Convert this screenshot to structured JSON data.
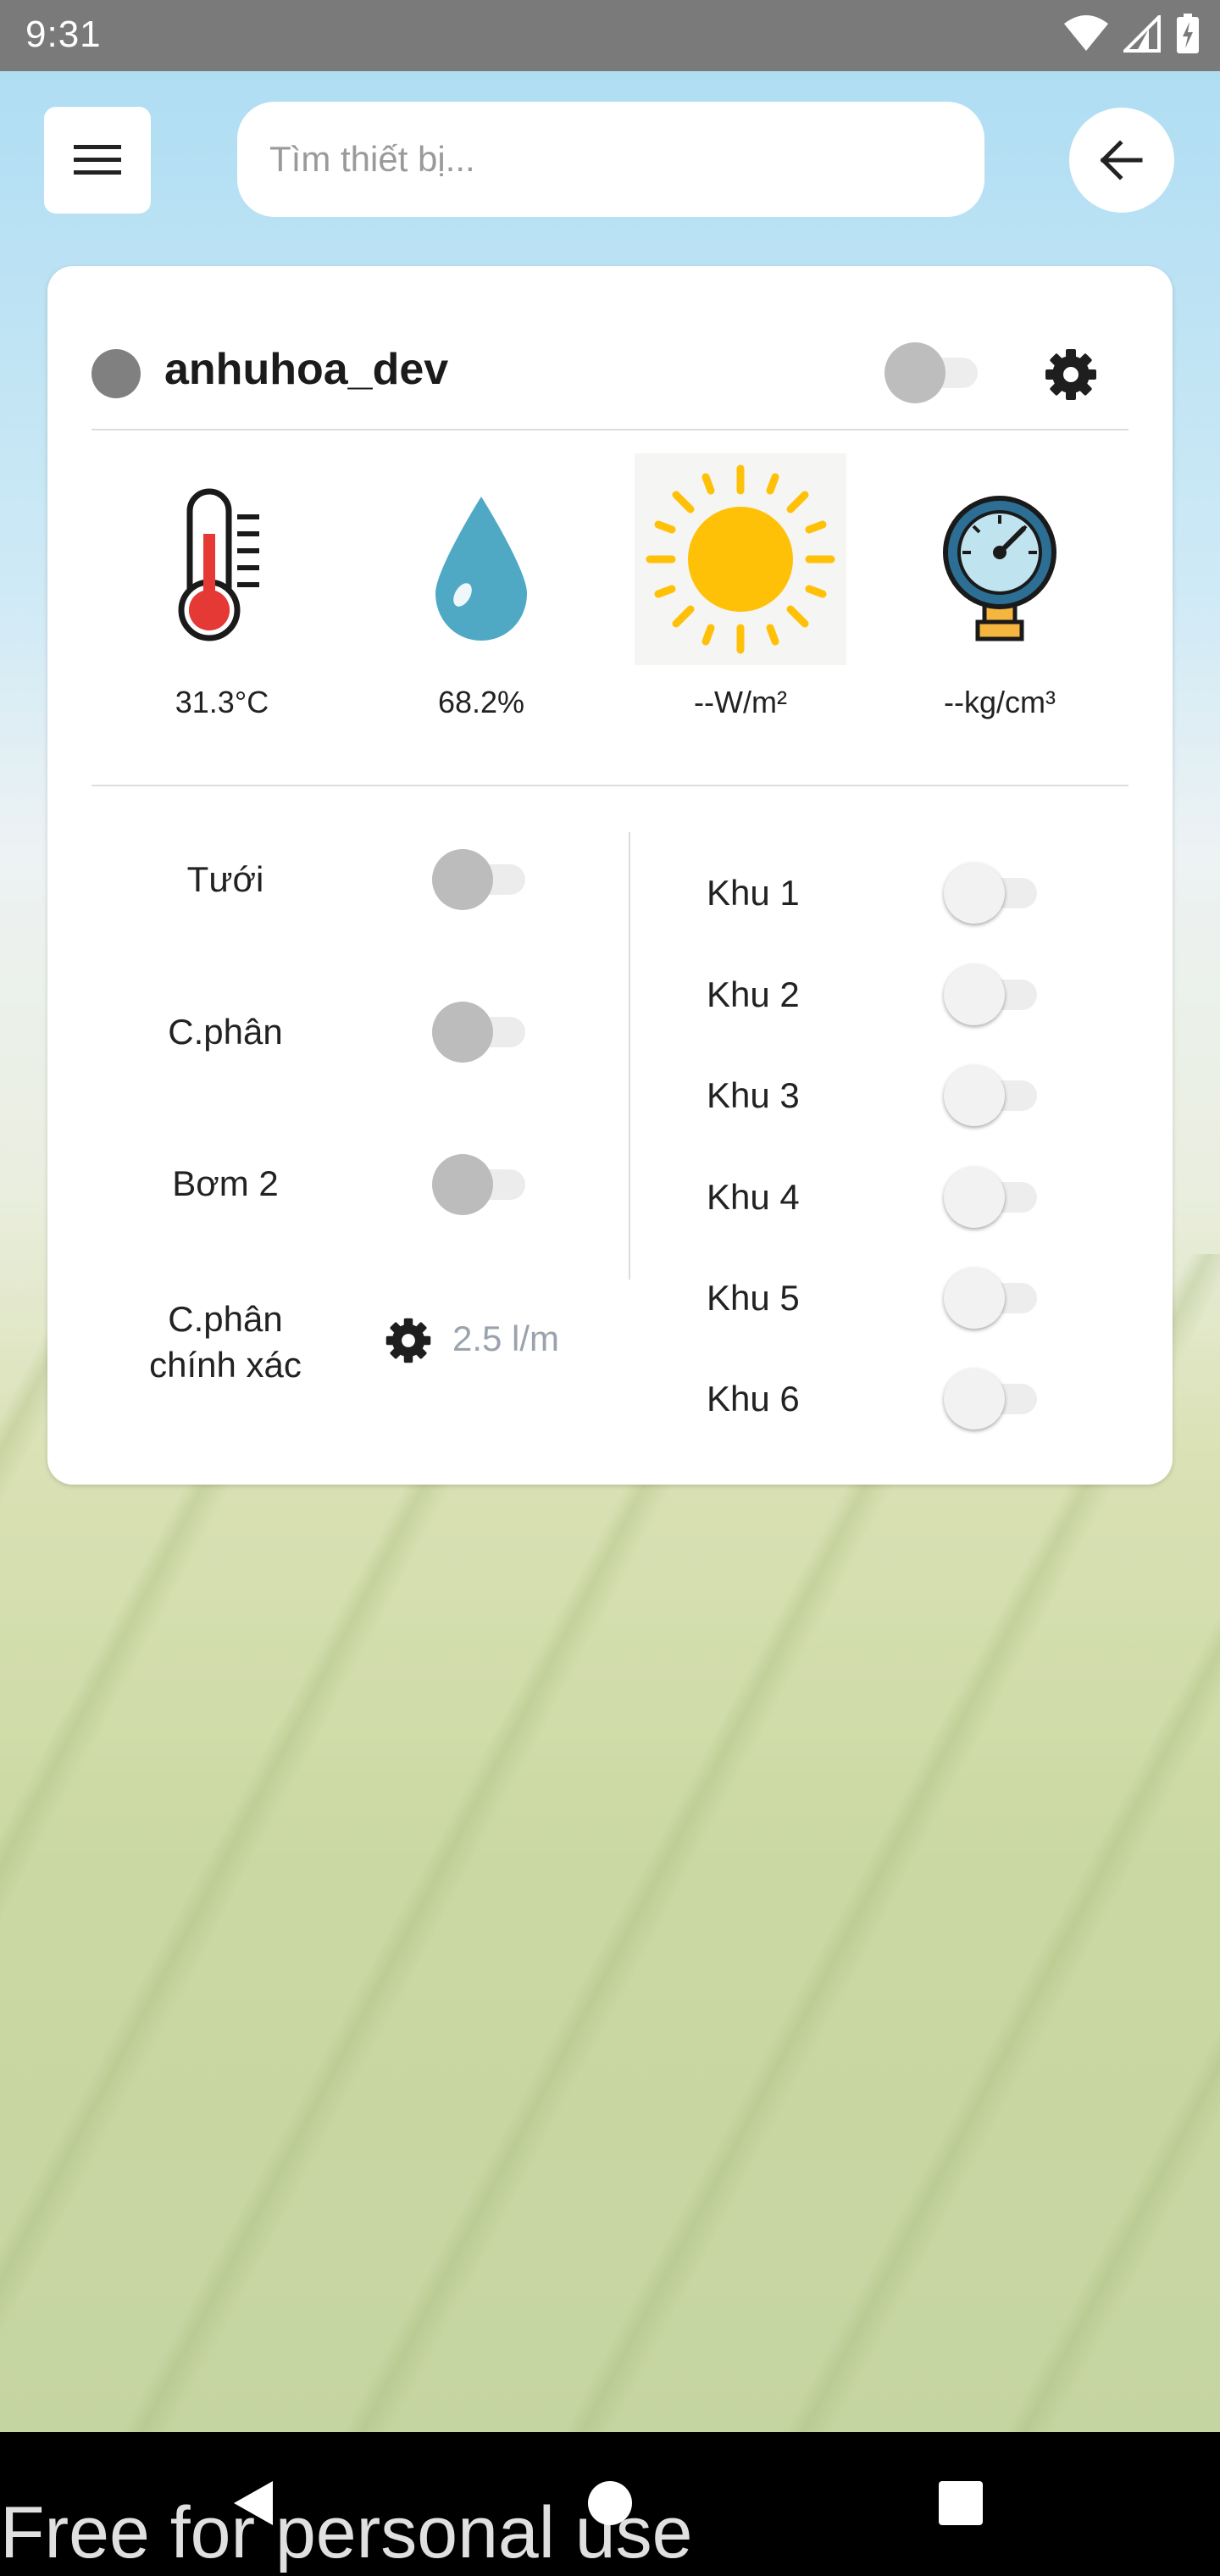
{
  "status_bar": {
    "time": "9:31"
  },
  "search": {
    "placeholder": "Tìm thiết bị..."
  },
  "device": {
    "name": "anhuhoa_dev",
    "online_color": "#808080",
    "power_on": false
  },
  "sensors": [
    {
      "icon": "thermometer-icon",
      "value": "31.3°C"
    },
    {
      "icon": "water-drop-icon",
      "value": "68.2%"
    },
    {
      "icon": "sun-icon",
      "value": "--W/m²"
    },
    {
      "icon": "pressure-gauge-icon",
      "value": "--kg/cm³"
    }
  ],
  "controls": {
    "tuoi": {
      "label": "Tưới",
      "on": false
    },
    "cphan": {
      "label": "C.phân",
      "on": false
    },
    "bom2": {
      "label": "Bơm 2",
      "on": false
    },
    "precise": {
      "label_line1": "C.phân",
      "label_line2": "chính xác",
      "rate": "2.5 l/m"
    }
  },
  "zones": [
    {
      "label": "Khu 1",
      "on": false
    },
    {
      "label": "Khu 2",
      "on": false
    },
    {
      "label": "Khu 3",
      "on": false
    },
    {
      "label": "Khu 4",
      "on": false
    },
    {
      "label": "Khu 5",
      "on": false
    },
    {
      "label": "Khu 6",
      "on": false
    }
  ],
  "watermark": "Free for personal use"
}
